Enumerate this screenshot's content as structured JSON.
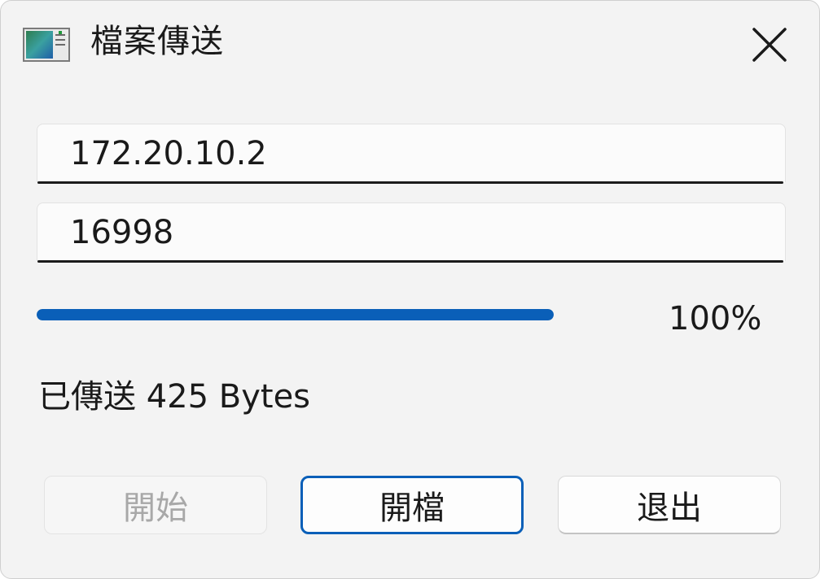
{
  "window": {
    "title": "檔案傳送",
    "app_icon": "app-window-icon",
    "close_icon": "close-icon"
  },
  "fields": {
    "ip_value": "172.20.10.2",
    "port_value": "16998"
  },
  "progress": {
    "value_percent": 100,
    "label": "100%"
  },
  "status": {
    "text": "已傳送 425 Bytes"
  },
  "buttons": {
    "start_label": "開始",
    "start_enabled": false,
    "open_label": "開檔",
    "exit_label": "退出"
  },
  "colors": {
    "accent": "#0a5fb8",
    "window_bg": "#f3f3f3",
    "disabled_text": "#a8a8a8"
  }
}
